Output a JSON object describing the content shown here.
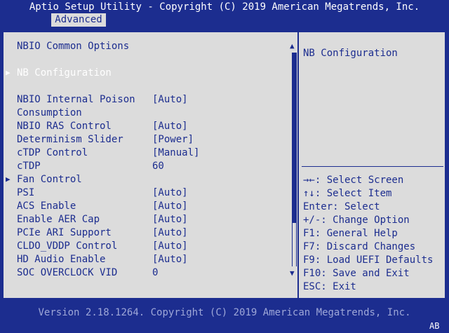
{
  "header": {
    "title": "Aptio Setup Utility - Copyright (C) 2019 American Megatrends, Inc.",
    "active_tab": "Advanced"
  },
  "left": {
    "section_title": "NBIO Common Options",
    "submenu_1": "NB Configuration",
    "items": [
      {
        "label": "NBIO Internal Poison",
        "value": "[Auto]"
      },
      {
        "label": "Consumption",
        "value": ""
      },
      {
        "label": "NBIO RAS Control",
        "value": "[Auto]"
      },
      {
        "label": "Determinism Slider",
        "value": "[Power]"
      },
      {
        "label": "cTDP Control",
        "value": "[Manual]"
      },
      {
        "label": "cTDP",
        "value": "60"
      }
    ],
    "submenu_2": "Fan Control",
    "items2": [
      {
        "label": "PSI",
        "value": "[Auto]"
      },
      {
        "label": "ACS Enable",
        "value": "[Auto]"
      },
      {
        "label": "Enable AER Cap",
        "value": "[Auto]"
      },
      {
        "label": "PCIe ARI Support",
        "value": "[Auto]"
      },
      {
        "label": "CLDO_VDDP Control",
        "value": "[Auto]"
      },
      {
        "label": "HD Audio Enable",
        "value": "[Auto]"
      },
      {
        "label": "SOC OVERCLOCK VID",
        "value": "0"
      }
    ]
  },
  "right": {
    "help_text": "NB Configuration",
    "keys": [
      "→←: Select Screen",
      "↑↓: Select Item",
      "Enter: Select",
      "+/-: Change Option",
      "F1: General Help",
      "F7: Discard Changes",
      "F9: Load UEFI Defaults",
      "F10: Save and Exit",
      "ESC: Exit"
    ]
  },
  "footer": {
    "version": "Version 2.18.1264. Copyright (C) 2019 American Megatrends, Inc.",
    "corner": "AB"
  }
}
